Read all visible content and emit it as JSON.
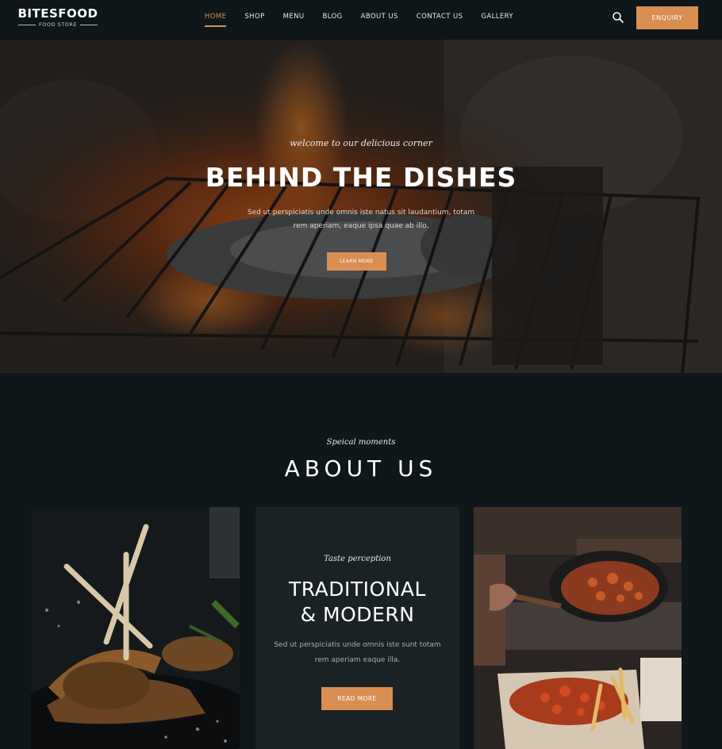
{
  "brand": {
    "name": "BITESFOOD",
    "tagline": "FOOD STORE"
  },
  "nav": {
    "items": [
      {
        "label": "HOME",
        "active": true
      },
      {
        "label": "SHOP",
        "active": false
      },
      {
        "label": "MENU",
        "active": false
      },
      {
        "label": "BLOG",
        "active": false
      },
      {
        "label": "ABOUT US",
        "active": false
      },
      {
        "label": "CONTACT US",
        "active": false
      },
      {
        "label": "GALLERY",
        "active": false
      }
    ],
    "search_icon": "search-icon",
    "enquiry_label": "ENQUIRY"
  },
  "hero": {
    "tagline": "welcome to our delicious corner",
    "title": "BEHIND THE DISHES",
    "text": "Sed ut perspiciatis unde omnis iste natus sit laudantium, totam rem aperiam, eaque ipsa quae ab illo.",
    "button_label": "LEARN MORE"
  },
  "about": {
    "tagline": "Speical moments",
    "title": "ABOUT US",
    "card": {
      "tagline": "Taste perception",
      "title_line1": "TRADITIONAL",
      "title_line2": "& MODERN",
      "text": "Sed ut perspiciatis unde omnis iste sunt totam rem aperiam eaque illa.",
      "button_label": "READ MORE"
    }
  },
  "colors": {
    "accent": "#d98e52",
    "background": "#0f171b",
    "card": "#1a2226"
  }
}
